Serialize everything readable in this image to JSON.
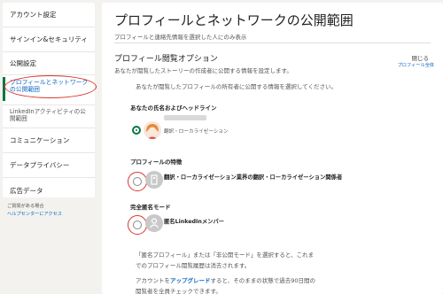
{
  "sidebar": {
    "items": [
      {
        "label": "アカウント設定"
      },
      {
        "label": "サインイン&セキュリティ"
      },
      {
        "label": "公開設定"
      },
      {
        "label": "プロフィールとネットワークの公開範囲"
      },
      {
        "label": "LinkedInアクティビティの公開範囲"
      },
      {
        "label": "コミュニケーション"
      },
      {
        "label": "データプライバシー"
      },
      {
        "label": "広告データ"
      }
    ],
    "help_text": "ご質問がある場合",
    "help_link": "ヘルプセンターにアクセス"
  },
  "main": {
    "title": "プロフィールとネットワークの公開範囲",
    "subtitle": "プロフィールと連絡先情報を選択した人にのみ表示",
    "section_title": "プロフィール閲覧オプション",
    "section_desc": "あなたが閲覧したストーリーの作成者に公開する情報を設定します。",
    "close_label": "閉じる",
    "close_sub": "プロフィール全体",
    "question": "あなたが閲覧したプロフィールの所有者に公開する情報を選択してください。",
    "options": [
      {
        "label": "あなたの氏名およびヘッドライン",
        "detail": "翻訳・ローカライゼーション",
        "selected": true
      },
      {
        "label": "プロフィールの特徴",
        "detail": "翻訳・ローカライゼーション業界の翻訳・ローカライゼーション関係者",
        "selected": false
      },
      {
        "label": "完全匿名モード",
        "detail": "匿名LinkedInメンバー",
        "selected": false
      }
    ],
    "info_line1": "「匿名プロフィール」または「非公開モード」を選択すると、これま",
    "info_line2": "でのプロフィール閲覧履歴は消去されます。",
    "info_line3_pre": "アカウントを",
    "info_line3_link": "アップグレード",
    "info_line3_post": "すると、そのままの状態で過去90日間の",
    "info_line4": "閲覧者を全員チェックできます。"
  },
  "colors": {
    "accent": "#057642",
    "link": "#0a66c2",
    "highlight": "#d9342b"
  }
}
